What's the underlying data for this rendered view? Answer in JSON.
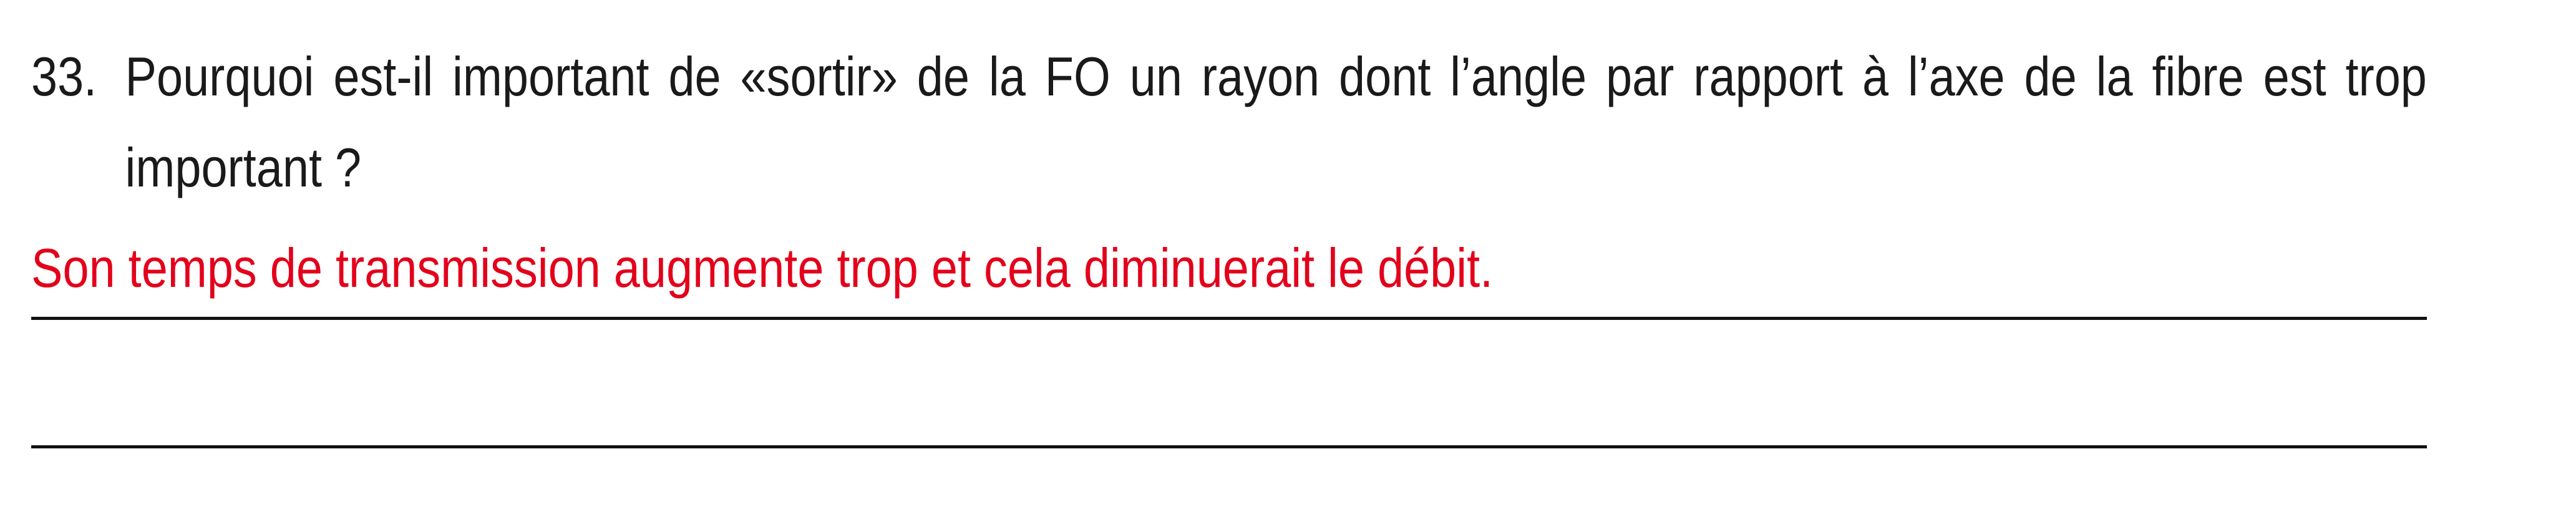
{
  "question": {
    "number": "33.",
    "text": "Pourquoi est-il important de «sortir» de la FO un rayon dont l’angle par rapport à l’axe de la fibre est trop important ?"
  },
  "answer": {
    "text": "Son temps de transmission augmente trop et cela diminuerait le débit.",
    "color": "#e3001b"
  }
}
